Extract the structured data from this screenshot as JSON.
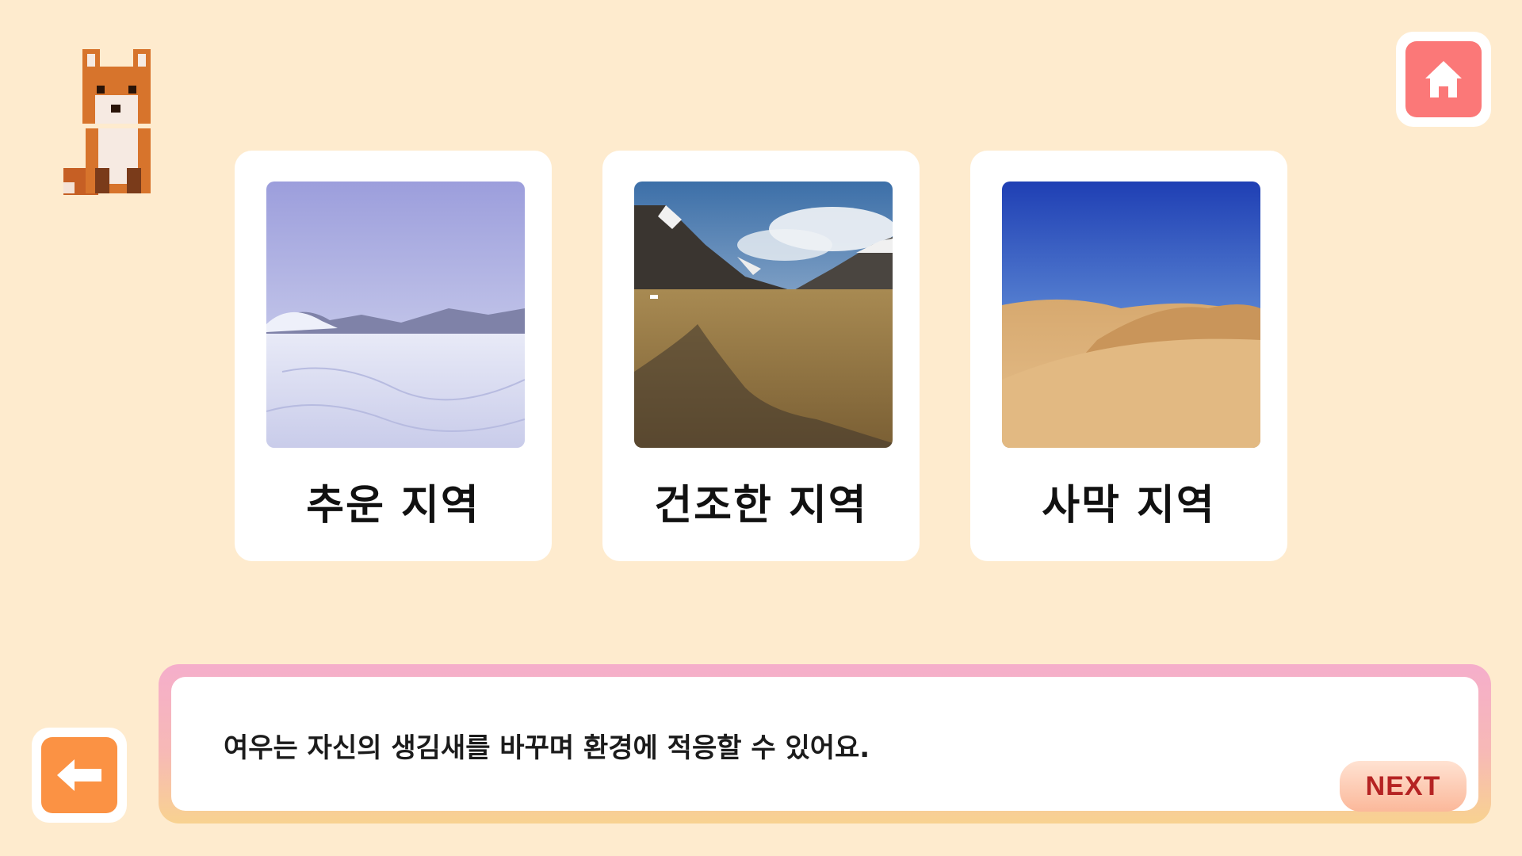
{
  "mascot": {
    "icon": "fox-icon"
  },
  "home_button": {
    "icon": "home-icon",
    "color": "#FB7878"
  },
  "back_button": {
    "icon": "arrow-left-icon",
    "color": "#FB9244"
  },
  "cards": [
    {
      "label": "추운 지역",
      "image": "snowfield-image"
    },
    {
      "label": "건조한 지역",
      "image": "dry-valley-image"
    },
    {
      "label": "사막 지역",
      "image": "desert-dunes-image"
    }
  ],
  "dialog": {
    "text": "여우는 자신의 생김새를 바꾸며 환경에 적응할 수 있어요.",
    "next_label": "NEXT"
  },
  "colors": {
    "background": "#FEEBCE",
    "next_text": "#B52323"
  }
}
